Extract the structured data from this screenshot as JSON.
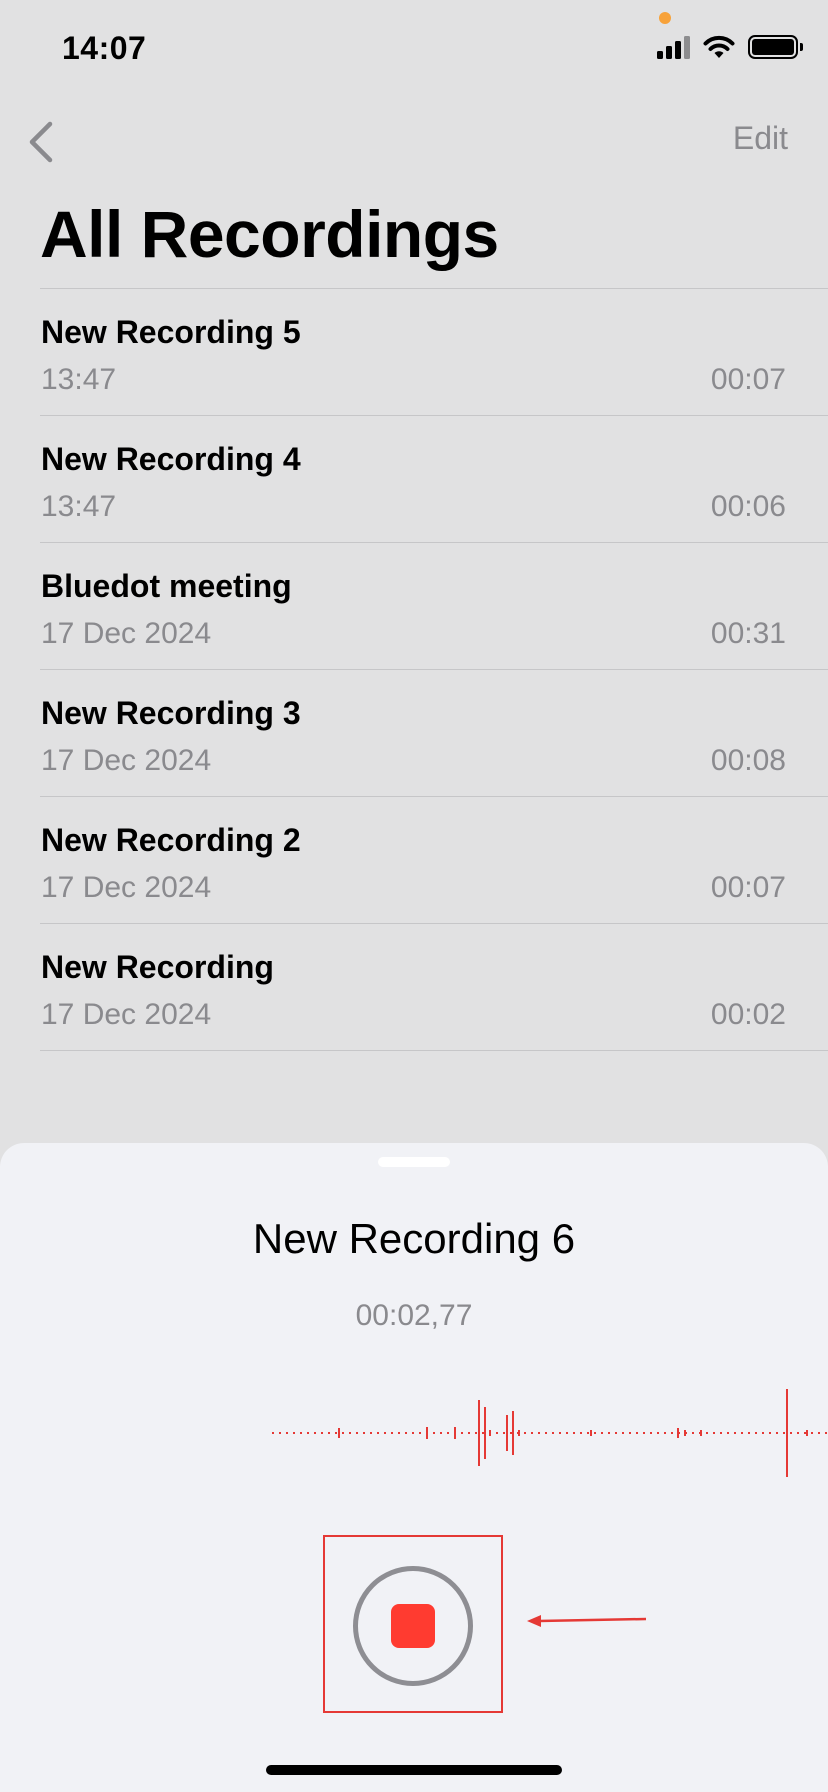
{
  "status_bar": {
    "time": "14:07",
    "icons": [
      "cellular-signal-icon",
      "wifi-icon",
      "battery-icon"
    ],
    "mic_indicator_color": "#f7a23a"
  },
  "nav": {
    "back_icon": "chevron-left-icon",
    "edit_label": "Edit"
  },
  "page_title": "All Recordings",
  "recordings": [
    {
      "title": "New Recording 5",
      "date": "13:47",
      "duration": "00:07"
    },
    {
      "title": "New Recording 4",
      "date": "13:47",
      "duration": "00:06"
    },
    {
      "title": "Bluedot meeting",
      "date": "17 Dec 2024",
      "duration": "00:31"
    },
    {
      "title": "New Recording 3",
      "date": "17 Dec 2024",
      "duration": "00:08"
    },
    {
      "title": "New Recording 2",
      "date": "17 Dec 2024",
      "duration": "00:07"
    },
    {
      "title": "New Recording",
      "date": "17 Dec 2024",
      "duration": "00:02"
    }
  ],
  "recording_sheet": {
    "title": "New Recording 6",
    "elapsed": "00:02,77",
    "stop_icon": "stop-icon",
    "waveform_color": "#e53935"
  },
  "colors": {
    "accent_red": "#ff3b30",
    "secondary_text": "#8a8a8e",
    "annotation_red": "#e53935"
  }
}
